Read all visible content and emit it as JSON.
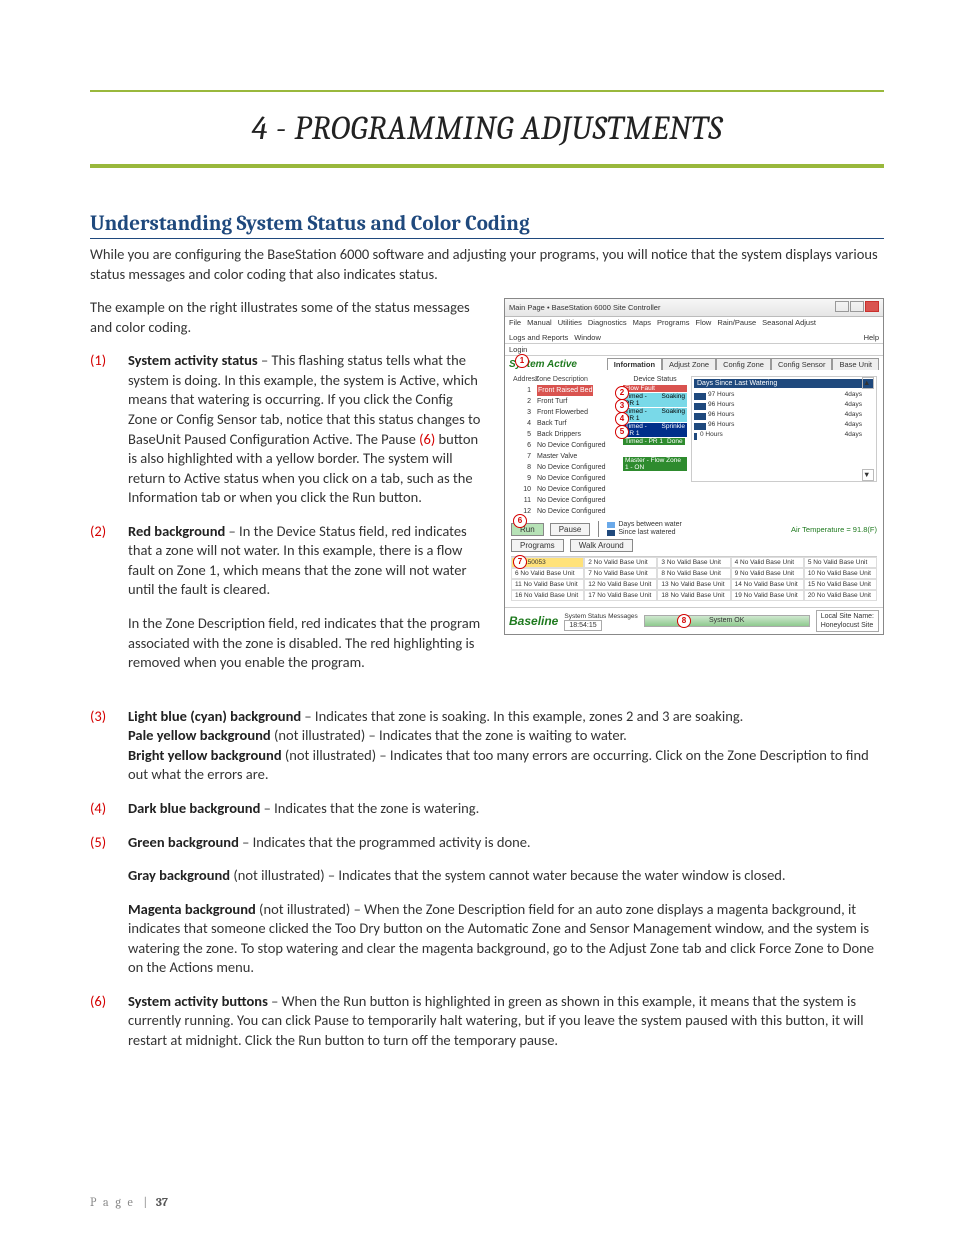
{
  "chapter": {
    "title": "4 - PROGRAMMING ADJUSTMENTS"
  },
  "section": {
    "title": "Understanding System Status and Color Coding",
    "intro": "While you are configuring the BaseStation 6000 software and adjusting your programs, you will notice that the system displays various status messages and color coding that also indicates status.",
    "example_intro": "The example on the right illustrates some of the status messages and color coding."
  },
  "items_left": {
    "n1": "(1)",
    "n2": "(2)",
    "i1_lead": "System activity status",
    "i1_body": " – This flashing status tells what the system is doing. In this example, the system is Active, which means that watering is occurring. If you click the Config Zone or Config Sensor tab, notice that this status changes to BaseUnit Paused Configuration Active. The Pause ",
    "i1_ref": "(6)",
    "i1_body2": " button is also highlighted with a yellow border. The system will return to Active status when you click on a tab, such as the Information tab or when you click the Run button.",
    "i2_lead": "Red background",
    "i2_body": " – In the Device Status field, red indicates that a zone will not water. In this example, there is a flow fault on Zone 1, which means that the zone will not water until the fault is cleared.",
    "i2_sub": "In the Zone Description field, red indicates that the program associated with the zone is disabled. The red highlighting is removed when you enable the program."
  },
  "items_full": {
    "n3": "(3)",
    "n4": "(4)",
    "n5": "(5)",
    "n6": "(6)",
    "i3_lead": "Light blue (cyan) background",
    "i3_body": " – Indicates that zone is soaking. In this example, zones 2 and 3 are soaking.",
    "i3_pale_lead": "Pale yellow background",
    "i3_pale_body": " (not illustrated) – Indicates that the zone is waiting to water.",
    "i3_bright_lead": "Bright yellow background",
    "i3_bright_body": " (not illustrated) – Indicates that too many errors are occurring. Click on the Zone Description to find out what the errors are.",
    "i4_lead": "Dark blue background",
    "i4_body": " – Indicates that the zone is watering.",
    "i5_lead": "Green background",
    "i5_body": " – Indicates that the programmed activity is done.",
    "i5_gray_lead": "Gray background",
    "i5_gray_body": " (not illustrated) – Indicates that the system cannot water because the water window is closed.",
    "i5_mag_lead": "Magenta background",
    "i5_mag_body": " (not illustrated) – When the Zone Description field for an auto zone displays a magenta background, it indicates that someone clicked the Too Dry button on the Automatic Zone and Sensor Management window, and the system is watering the zone. To stop watering and clear the magenta background, go to the Adjust Zone tab and click Force Zone to Done on the Actions menu.",
    "i6_lead": "System activity buttons",
    "i6_body": " – When the Run button is highlighted in green as shown in this example, it means that the system is currently running. You can click Pause to temporarily halt watering, but if you leave the system paused with this button, it will restart at midnight. Click the Run button to turn off the temporary pause."
  },
  "footer": {
    "page_label": "P a g e",
    "sep": "|",
    "num": "37"
  },
  "shot": {
    "title": "Main Page • BaseStation 6000 Site Controller",
    "menu": [
      "File",
      "Manual",
      "Utilities",
      "Diagnostics",
      "Maps",
      "Programs",
      "Flow",
      "Rain/Pause",
      "Seasonal Adjust",
      "Logs and Reports",
      "Window",
      "Help"
    ],
    "login": "Login",
    "system_active": "System Active",
    "tabs": [
      "Information",
      "Adjust Zone",
      "Config Zone",
      "Config Sensor",
      "Base Unit"
    ],
    "zone_header": {
      "addr": "Address",
      "desc": "Zone Description"
    },
    "zones": [
      {
        "n": "1",
        "d": "Front Raised Bed"
      },
      {
        "n": "2",
        "d": "Front Turf"
      },
      {
        "n": "3",
        "d": "Front Flowerbed"
      },
      {
        "n": "4",
        "d": "Back Turf"
      },
      {
        "n": "5",
        "d": "Back Drippers"
      },
      {
        "n": "6",
        "d": "No Device Configured"
      },
      {
        "n": "7",
        "d": "Master Valve"
      },
      {
        "n": "8",
        "d": "No Device Configured"
      },
      {
        "n": "9",
        "d": "No Device Configured"
      },
      {
        "n": "10",
        "d": "No Device Configured"
      },
      {
        "n": "11",
        "d": "No Device Configured"
      },
      {
        "n": "12",
        "d": "No Device Configured"
      }
    ],
    "status_header": "Device Status",
    "chips": [
      {
        "a": "Flow Fault",
        "b": "",
        "cls": "chip-red"
      },
      {
        "a": "Timed - PR 1",
        "b": "Soaking",
        "cls": "chip-cyan"
      },
      {
        "a": "Timed - PR 1",
        "b": "Soaking",
        "cls": "chip-cyan"
      },
      {
        "a": "Timed - PR 1",
        "b": "Sprinkle",
        "cls": "chip-blue"
      },
      {
        "a": "Timed - PR 1",
        "b": "Done",
        "cls": "chip-green"
      }
    ],
    "master_chip": "Master - Flow Zone 1 - ON",
    "graph_header": "Days Since Last Watering",
    "graph_vals": [
      "97 Hours",
      "96 Hours",
      "96 Hours",
      "96 Hours",
      "0 Hours"
    ],
    "graph_right": [
      "4days",
      "4days",
      "4days",
      "4days",
      "4days"
    ],
    "run": "Run",
    "pause": "Pause",
    "programs": "Programs",
    "walk": "Walk Around",
    "days_between": "Days between water",
    "since_last": "Since last watered",
    "airtemp": "Air Temperature = 91.8(F)",
    "unit_first": "1:0150053",
    "unit_other": "No Valid Base Unit",
    "brand": "Baseline",
    "stat_label": "System Status Messages",
    "time": "18:54:15",
    "stat_bar": "System OK",
    "sitebox_label": "Local Site Name:",
    "sitebox_val": "Honeylocust Site",
    "callouts": {
      "c1": "1",
      "c2": "2",
      "c3": "3",
      "c4": "4",
      "c5": "5",
      "c6": "6",
      "c7": "7",
      "c8": "8"
    }
  }
}
